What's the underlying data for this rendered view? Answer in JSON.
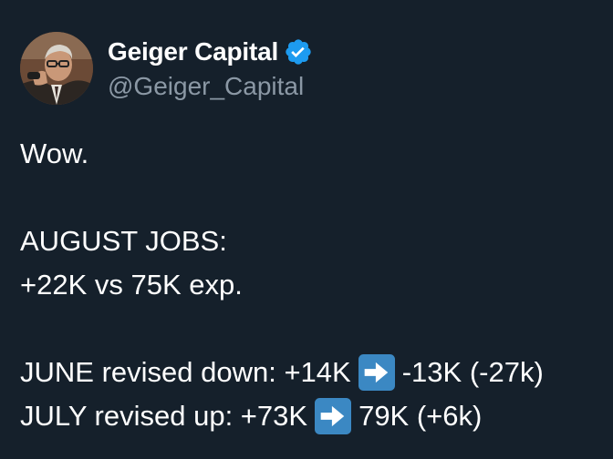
{
  "author": {
    "display_name": "Geiger Capital",
    "handle": "@Geiger_Capital",
    "verified_icon": "verified-badge-icon",
    "avatar": "profile-photo"
  },
  "colors": {
    "background": "#15202b",
    "text_primary": "#ffffff",
    "text_secondary": "#8b98a5",
    "verified_blue": "#1d9bf0",
    "arrow_emoji_blue": "#3b88c3"
  },
  "tweet": {
    "line1": "Wow.",
    "line2": "AUGUST JOBS:",
    "line3": "+22K vs 75K exp.",
    "line4_before": "JUNE revised down: +14K",
    "line4_after": "-13K (-27k)",
    "line5_before": "JULY revised up: +73K",
    "line5_after": "79K (+6k)",
    "arrow_icon": "right-arrow-emoji-icon"
  }
}
